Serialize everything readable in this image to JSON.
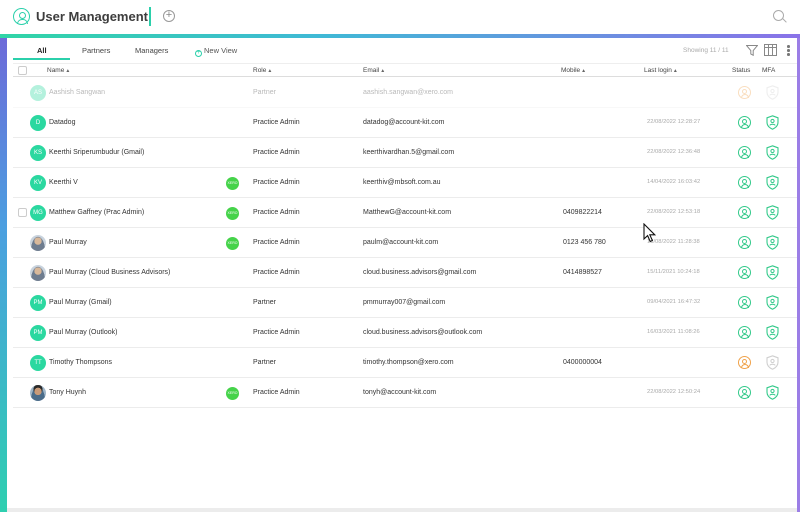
{
  "app": {
    "title": "User Management"
  },
  "tabs": [
    {
      "label": "All",
      "active": true
    },
    {
      "label": "Partners",
      "active": false
    },
    {
      "label": "Managers",
      "active": false
    }
  ],
  "new_view_label": "New View",
  "showing_text": "Showing 11 / 11",
  "columns": {
    "name": "Name",
    "role": "Role",
    "email": "Email",
    "mobile": "Mobile",
    "last_login": "Last login",
    "status": "Status",
    "mfa": "MFA"
  },
  "rows": [
    {
      "initials": "AS",
      "name": "Aashish Sangwan",
      "role": "Partner",
      "email": "aashish.sangwan@xero.com",
      "mobile": "",
      "last_login": "",
      "badge": "",
      "status": "pending",
      "mfa": "off",
      "faded": true
    },
    {
      "initials": "D",
      "name": "Datadog",
      "role": "Practice Admin",
      "email": "datadog@account-kit.com",
      "mobile": "",
      "last_login": "22/08/2022 12:28:27",
      "badge": "",
      "status": "active",
      "mfa": "on"
    },
    {
      "initials": "KS",
      "name": "Keerthi Sriperumbudur (Gmail)",
      "role": "Practice Admin",
      "email": "keerthivardhan.5@gmail.com",
      "mobile": "",
      "last_login": "22/08/2022 12:36:48",
      "badge": "",
      "status": "active",
      "mfa": "on"
    },
    {
      "initials": "KV",
      "name": "Keerthi V",
      "role": "Practice Admin",
      "email": "keerthiv@mbsoft.com.au",
      "mobile": "",
      "last_login": "14/04/2022 16:03:42",
      "badge": "XERO",
      "status": "active",
      "mfa": "on"
    },
    {
      "initials": "MG",
      "name": "Matthew Gaffney (Prac Admin)",
      "role": "Practice Admin",
      "email": "MatthewG@account-kit.com",
      "mobile": "0409822214",
      "last_login": "22/08/2022 12:53:18",
      "badge": "XERO",
      "status": "active",
      "mfa": "on",
      "checkbox": true
    },
    {
      "initials": "PM",
      "photo": true,
      "name": "Paul Murray",
      "role": "Practice Admin",
      "email": "paulm@account-kit.com",
      "mobile": "0123 456 780",
      "last_login": "18/08/2022 11:28:38",
      "badge": "XERO",
      "status": "active",
      "mfa": "on"
    },
    {
      "initials": "PM",
      "photo": true,
      "name": "Paul Murray (Cloud Business Advisors)",
      "role": "Practice Admin",
      "email": "cloud.business.advisors@gmail.com",
      "mobile": "0414898527",
      "last_login": "15/11/2021 10:24:18",
      "badge": "",
      "status": "active",
      "mfa": "on"
    },
    {
      "initials": "PM",
      "name": "Paul Murray (Gmail)",
      "role": "Partner",
      "email": "pmmurray007@gmail.com",
      "mobile": "",
      "last_login": "09/04/2021 16:47:32",
      "badge": "",
      "status": "active",
      "mfa": "on"
    },
    {
      "initials": "PM",
      "name": "Paul Murray (Outlook)",
      "role": "Practice Admin",
      "email": "cloud.business.advisors@outlook.com",
      "mobile": "",
      "last_login": "16/03/2021 11:08:26",
      "badge": "",
      "status": "active",
      "mfa": "on"
    },
    {
      "initials": "TT",
      "name": "Timothy Thompsons",
      "role": "Partner",
      "email": "timothy.thompson@xero.com",
      "mobile": "0400000004",
      "last_login": "",
      "badge": "",
      "status": "pending",
      "mfa": "off"
    },
    {
      "initials": "TH",
      "photo": true,
      "dark": true,
      "name": "Tony Huynh",
      "role": "Practice Admin",
      "email": "tonyh@account-kit.com",
      "mobile": "",
      "last_login": "22/08/2022 12:50:24",
      "badge": "XERO",
      "status": "active",
      "mfa": "on"
    }
  ],
  "colors": {
    "accent": "#2bd0ab",
    "avatar": "#2bd8a0",
    "badge": "#45d34a",
    "status_active": "#33c98a",
    "status_pending": "#f0a24a",
    "mfa_on": "#33c98a",
    "mfa_off": "#cfcfcf"
  }
}
